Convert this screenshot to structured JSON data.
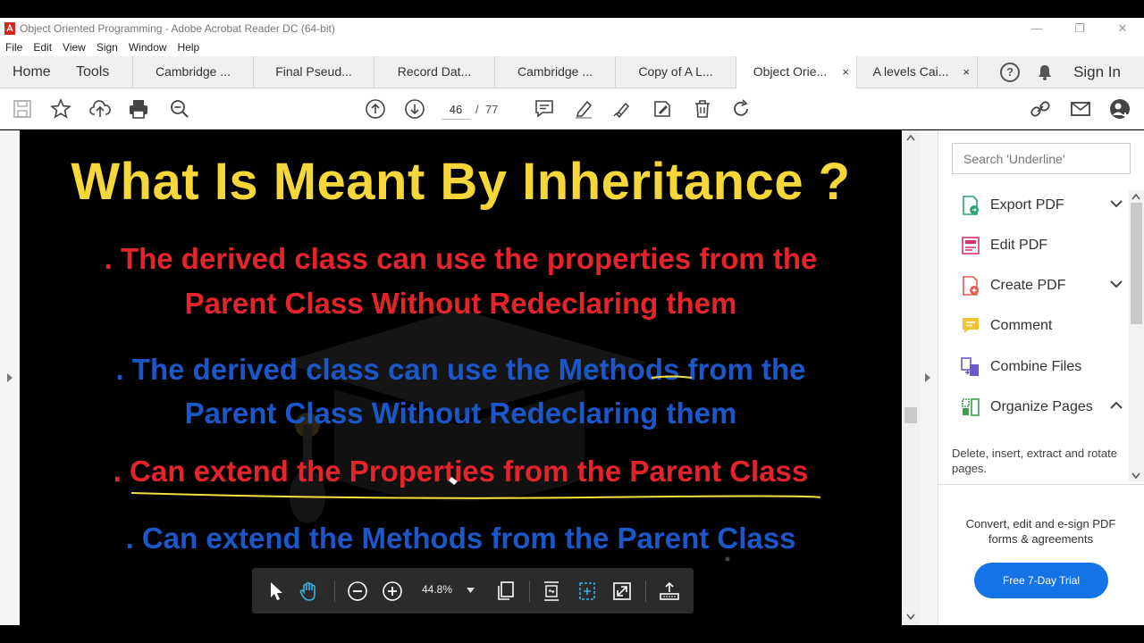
{
  "window": {
    "title": "Object Oriented Programming - Adobe Acrobat Reader DC (64-bit)",
    "minimize": "—",
    "restore": "❐",
    "close": "✕"
  },
  "menu": [
    "File",
    "Edit",
    "View",
    "Sign",
    "Window",
    "Help"
  ],
  "nav": {
    "home": "Home",
    "tools": "Tools"
  },
  "tabs": [
    {
      "label": "Cambridge ..."
    },
    {
      "label": "Final Pseud..."
    },
    {
      "label": "Record Dat..."
    },
    {
      "label": "Cambridge ..."
    },
    {
      "label": "Copy of A L..."
    },
    {
      "label": "Object Orie...",
      "active": true
    },
    {
      "label": "A levels Cai..."
    }
  ],
  "tab_close": "×",
  "header_right": {
    "help": "?",
    "signin": "Sign In"
  },
  "page": {
    "current": "46",
    "separator": "/",
    "total": "77"
  },
  "slide": {
    "title": "What Is Meant By Inheritance ?",
    "lines": [
      {
        "text": ". The derived class can use the properties from the",
        "color": "red"
      },
      {
        "text": "Parent Class Without Redeclaring them",
        "color": "red"
      },
      {
        "text": ". The derived class can use the Methods from the",
        "color": "blue"
      },
      {
        "text": "Parent Class Without Redeclaring them",
        "color": "blue"
      },
      {
        "text": ". Can extend the Properties from the Parent Class",
        "color": "red"
      },
      {
        "text": ". Can extend the Methods from the Parent Class",
        "color": "blue"
      }
    ]
  },
  "floating_toolbar": {
    "zoom": "44.8%"
  },
  "right_pane": {
    "search_placeholder": "Search 'Underline'",
    "tools": [
      {
        "label": "Export PDF",
        "icon": "export-pdf-icon",
        "chevron": "down"
      },
      {
        "label": "Edit PDF",
        "icon": "edit-pdf-icon"
      },
      {
        "label": "Create PDF",
        "icon": "create-pdf-icon",
        "chevron": "down"
      },
      {
        "label": "Comment",
        "icon": "comment-icon"
      },
      {
        "label": "Combine Files",
        "icon": "combine-files-icon"
      },
      {
        "label": "Organize Pages",
        "icon": "organize-pages-icon",
        "chevron": "up"
      }
    ],
    "description": "Delete, insert, extract and rotate pages.",
    "promo": "Convert, edit and e-sign PDF forms & agreements",
    "trial_button": "Free 7-Day Trial"
  },
  "colors": {
    "slide_title": "#f5d73a",
    "red_text": "#e4232b",
    "blue_text": "#1c57c9",
    "accent": "#1473e6",
    "annotation_underline": "#f2e23a"
  }
}
